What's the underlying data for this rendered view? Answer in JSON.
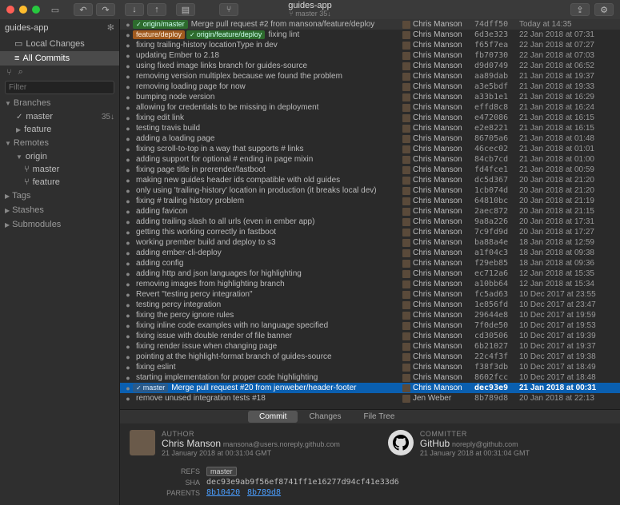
{
  "window": {
    "title": "guides-app",
    "subtitle_branch": "master",
    "subtitle_count": "35↓"
  },
  "sidebar": {
    "repo_name": "guides-app",
    "local_changes": "Local Changes",
    "all_commits": "All Commits",
    "search_placeholder": "",
    "filter_placeholder": "Filter",
    "sections": {
      "branches": "Branches",
      "remotes": "Remotes",
      "tags": "Tags",
      "stashes": "Stashes",
      "submodules": "Submodules"
    },
    "branches": [
      {
        "name": "master",
        "count": "35↓",
        "current": true
      },
      {
        "name": "feature",
        "count": ""
      }
    ],
    "remotes": [
      {
        "name": "origin",
        "children": [
          "master",
          "feature"
        ]
      }
    ]
  },
  "commits": [
    {
      "badges": [
        {
          "text": "origin/master",
          "color": "green",
          "check": true
        }
      ],
      "msg": "Merge pull request #2 from mansona/feature/deploy",
      "author": "Chris Manson",
      "hash": "74dff50",
      "date": "Today at 14:35",
      "first": true
    },
    {
      "badges": [
        {
          "text": "feature/deploy",
          "color": "orange"
        },
        {
          "text": "origin/feature/deploy",
          "color": "green",
          "check": true
        }
      ],
      "msg": "fixing lint",
      "author": "Chris Manson",
      "hash": "6d3e323",
      "date": "22 Jan 2018 at 07:31"
    },
    {
      "msg": "fixing trailing-history locationType in dev",
      "author": "Chris Manson",
      "hash": "f65f7ea",
      "date": "22 Jan 2018 at 07:27"
    },
    {
      "msg": "updating Ember to 2.18",
      "author": "Chris Manson",
      "hash": "fb70730",
      "date": "22 Jan 2018 at 07:03"
    },
    {
      "msg": "using fixed image links branch for guides-source",
      "author": "Chris Manson",
      "hash": "d9d0749",
      "date": "22 Jan 2018 at 06:52"
    },
    {
      "msg": "removing version multiplex because we found the problem",
      "author": "Chris Manson",
      "hash": "aa89dab",
      "date": "21 Jan 2018 at 19:37"
    },
    {
      "msg": "removing loading page for now",
      "author": "Chris Manson",
      "hash": "a3e5bdf",
      "date": "21 Jan 2018 at 19:33"
    },
    {
      "msg": "bumping node version",
      "author": "Chris Manson",
      "hash": "a33b1e1",
      "date": "21 Jan 2018 at 16:29"
    },
    {
      "msg": "allowing for credentials to be missing in deployment",
      "author": "Chris Manson",
      "hash": "effd8c8",
      "date": "21 Jan 2018 at 16:24"
    },
    {
      "msg": "fixing edit link",
      "author": "Chris Manson",
      "hash": "e472086",
      "date": "21 Jan 2018 at 16:15"
    },
    {
      "msg": "testing travis build",
      "author": "Chris Manson",
      "hash": "e2e8221",
      "date": "21 Jan 2018 at 16:15"
    },
    {
      "msg": "adding a loading page",
      "author": "Chris Manson",
      "hash": "86705a6",
      "date": "21 Jan 2018 at 01:48"
    },
    {
      "msg": "fixing scroll-to-top in a way that supports # links",
      "author": "Chris Manson",
      "hash": "46cec02",
      "date": "21 Jan 2018 at 01:01"
    },
    {
      "msg": "adding support for optional # ending in page mixin",
      "author": "Chris Manson",
      "hash": "84cb7cd",
      "date": "21 Jan 2018 at 01:00"
    },
    {
      "msg": "fixing page title in prerender/fastboot",
      "author": "Chris Manson",
      "hash": "fd4fce1",
      "date": "21 Jan 2018 at 00:59"
    },
    {
      "msg": "making new guides header ids compatible with old guides",
      "author": "Chris Manson",
      "hash": "dc5d367",
      "date": "20 Jan 2018 at 21:20"
    },
    {
      "msg": "only using 'trailing-history' location in production (it breaks local dev)",
      "author": "Chris Manson",
      "hash": "1cb074d",
      "date": "20 Jan 2018 at 21:20"
    },
    {
      "msg": "fixing # trailing history problem",
      "author": "Chris Manson",
      "hash": "64810bc",
      "date": "20 Jan 2018 at 21:19"
    },
    {
      "msg": "adding favicon",
      "author": "Chris Manson",
      "hash": "2aec872",
      "date": "20 Jan 2018 at 21:15"
    },
    {
      "msg": "adding trailing slash to all urls (even in ember app)",
      "author": "Chris Manson",
      "hash": "9a8a226",
      "date": "20 Jan 2018 at 17:31"
    },
    {
      "msg": "getting this working correctly in fastboot",
      "author": "Chris Manson",
      "hash": "7c9fd9d",
      "date": "20 Jan 2018 at 17:27"
    },
    {
      "msg": "working prember build and deploy to s3",
      "author": "Chris Manson",
      "hash": "ba88a4e",
      "date": "18 Jan 2018 at 12:59"
    },
    {
      "msg": "adding ember-cli-deploy",
      "author": "Chris Manson",
      "hash": "a1f04c3",
      "date": "18 Jan 2018 at 09:38"
    },
    {
      "msg": "adding config",
      "author": "Chris Manson",
      "hash": "f29eb85",
      "date": "18 Jan 2018 at 09:36"
    },
    {
      "msg": "adding http and json languages for highlighting",
      "author": "Chris Manson",
      "hash": "ec712a6",
      "date": "12 Jan 2018 at 15:35"
    },
    {
      "msg": "removing images from highlighting branch",
      "author": "Chris Manson",
      "hash": "a10bb64",
      "date": "12 Jan 2018 at 15:34"
    },
    {
      "msg": "Revert \"testing percy integration\"",
      "author": "Chris Manson",
      "hash": "fc5ad63",
      "date": "10 Dec 2017 at 23:55"
    },
    {
      "msg": "testing percy integration",
      "author": "Chris Manson",
      "hash": "1e856fd",
      "date": "10 Dec 2017 at 23:47"
    },
    {
      "msg": "fixing the percy ignore rules",
      "author": "Chris Manson",
      "hash": "29644e8",
      "date": "10 Dec 2017 at 19:59"
    },
    {
      "msg": "fixing inline code examples with no language specified",
      "author": "Chris Manson",
      "hash": "7f0de50",
      "date": "10 Dec 2017 at 19:53"
    },
    {
      "msg": "fixing issue with double render of file banner",
      "author": "Chris Manson",
      "hash": "cd30506",
      "date": "10 Dec 2017 at 19:39"
    },
    {
      "msg": "fixing render issue when changing page",
      "author": "Chris Manson",
      "hash": "6b21027",
      "date": "10 Dec 2017 at 19:37"
    },
    {
      "msg": "pointing at the highlight-format branch of guides-source",
      "author": "Chris Manson",
      "hash": "22c4f3f",
      "date": "10 Dec 2017 at 19:38"
    },
    {
      "msg": "fixing eslint",
      "author": "Chris Manson",
      "hash": "f38f3db",
      "date": "10 Dec 2017 at 18:49"
    },
    {
      "msg": "starting implementation for proper code highlighting",
      "author": "Chris Manson",
      "hash": "8602fcc",
      "date": "10 Dec 2017 at 18:48"
    },
    {
      "badges": [
        {
          "text": "master",
          "color": "blue",
          "check": true
        }
      ],
      "msg": "Merge pull request #20 from jenweber/header-footer",
      "author": "Chris Manson",
      "hash": "dec93e9",
      "date": "21 Jan 2018 at 00:31",
      "selected": true
    },
    {
      "msg": "remove unused integration tests #18",
      "author": "Jen Weber",
      "hash": "8b789d8",
      "date": "20 Jan 2018 at 22:13"
    }
  ],
  "detail_tabs": [
    "Commit",
    "Changes",
    "File Tree"
  ],
  "detail": {
    "author": {
      "label": "AUTHOR",
      "name": "Chris Manson",
      "email": "mansona@users.noreply.github.com",
      "date": "21 January 2018 at 00:31:04 GMT"
    },
    "committer": {
      "label": "COMMITTER",
      "name": "GitHub",
      "email": "noreply@github.com",
      "date": "21 January 2018 at 00:31:04 GMT"
    },
    "refs_label": "REFS",
    "refs": "master",
    "sha_label": "SHA",
    "sha": "dec93e9ab9f56ef8741ff1e16277d94cf41e33d6",
    "parents_label": "PARENTS",
    "parents": [
      "8b10420",
      "8b789d8"
    ]
  }
}
